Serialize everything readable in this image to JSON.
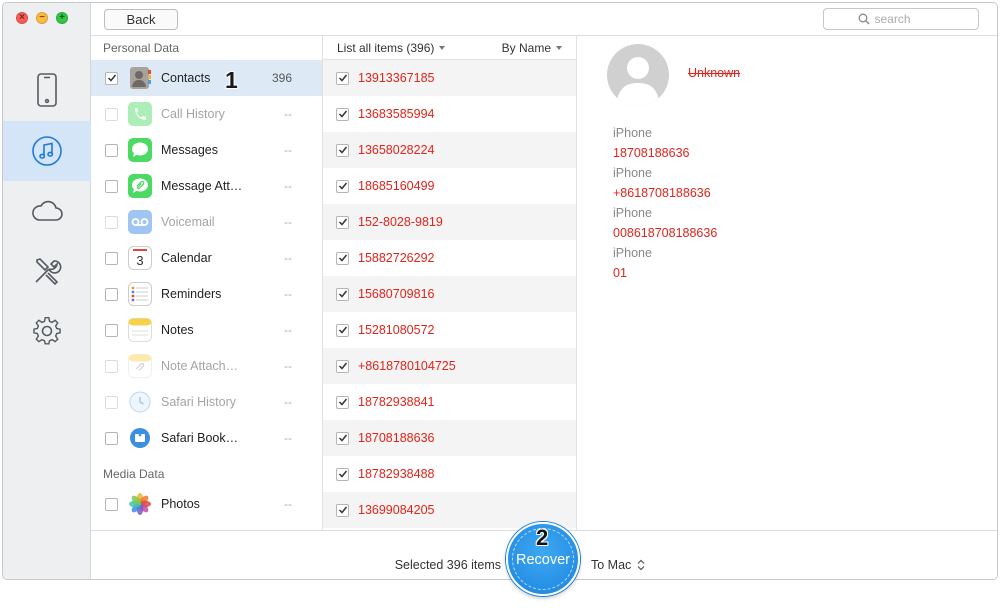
{
  "window": {
    "traffic": {
      "close_glyph": "×",
      "min_glyph": "−",
      "max_glyph": "+"
    },
    "colors": {
      "close": "#fc5d57",
      "minimize": "#fdbc40",
      "maximize": "#33c748",
      "accent": "#1f7ad8",
      "red_text": "#e0241b"
    }
  },
  "rail": {
    "items": [
      {
        "name": "device-icon",
        "active": false
      },
      {
        "name": "music-note-icon",
        "active": true
      },
      {
        "name": "cloud-icon",
        "active": false
      },
      {
        "name": "tools-icon",
        "active": false
      },
      {
        "name": "gear-icon",
        "active": false
      }
    ]
  },
  "toolbar": {
    "back_label": "Back",
    "search_placeholder": "search"
  },
  "categories": {
    "personal_title": "Personal Data",
    "media_title": "Media Data",
    "step1_label": "1",
    "personal": [
      {
        "label": "Contacts",
        "count": "396",
        "checked": true,
        "dim": false,
        "selected": true,
        "icon": "contacts-icon"
      },
      {
        "label": "Call History",
        "count": "--",
        "checked": false,
        "dim": true,
        "selected": false,
        "icon": "phone-icon"
      },
      {
        "label": "Messages",
        "count": "--",
        "checked": false,
        "dim": false,
        "selected": false,
        "icon": "messages-icon"
      },
      {
        "label": "Message Att…",
        "count": "--",
        "checked": false,
        "dim": false,
        "selected": false,
        "icon": "message-attachment-icon"
      },
      {
        "label": "Voicemail",
        "count": "--",
        "checked": false,
        "dim": true,
        "selected": false,
        "icon": "voicemail-icon"
      },
      {
        "label": "Calendar",
        "count": "--",
        "checked": false,
        "dim": false,
        "selected": false,
        "icon": "calendar-icon",
        "calendar_day": "3"
      },
      {
        "label": "Reminders",
        "count": "--",
        "checked": false,
        "dim": false,
        "selected": false,
        "icon": "reminders-icon"
      },
      {
        "label": "Notes",
        "count": "--",
        "checked": false,
        "dim": false,
        "selected": false,
        "icon": "notes-icon"
      },
      {
        "label": "Note Attach…",
        "count": "--",
        "checked": false,
        "dim": true,
        "selected": false,
        "icon": "note-attachment-icon"
      },
      {
        "label": "Safari History",
        "count": "--",
        "checked": false,
        "dim": true,
        "selected": false,
        "icon": "safari-history-icon"
      },
      {
        "label": "Safari Book…",
        "count": "--",
        "checked": false,
        "dim": false,
        "selected": false,
        "icon": "safari-bookmark-icon"
      }
    ],
    "media": [
      {
        "label": "Photos",
        "count": "--",
        "checked": false,
        "dim": false,
        "selected": false,
        "icon": "photos-icon"
      }
    ]
  },
  "items": {
    "list_label": "List all items (396)",
    "sort_label": "By Name",
    "rows": [
      "13913367185",
      "13683585994",
      "13658028224",
      "18685160499",
      "152-8028-9819",
      "15882726292",
      "15680709816",
      "15281080572",
      "+8618780104725",
      "18782938841",
      "18708188636",
      "18782938488",
      "13699084205"
    ]
  },
  "detail": {
    "name": "Unknown",
    "fields": [
      {
        "label": "iPhone",
        "value": "18708188636"
      },
      {
        "label": "iPhone",
        "value": "+8618708188636"
      },
      {
        "label": "iPhone",
        "value": "008618708188636"
      },
      {
        "label": "iPhone",
        "value": "01"
      }
    ]
  },
  "bottom": {
    "selected_text": "Selected 396 items",
    "recover_label": "Recover",
    "destination": "To Mac",
    "step2_label": "2"
  }
}
